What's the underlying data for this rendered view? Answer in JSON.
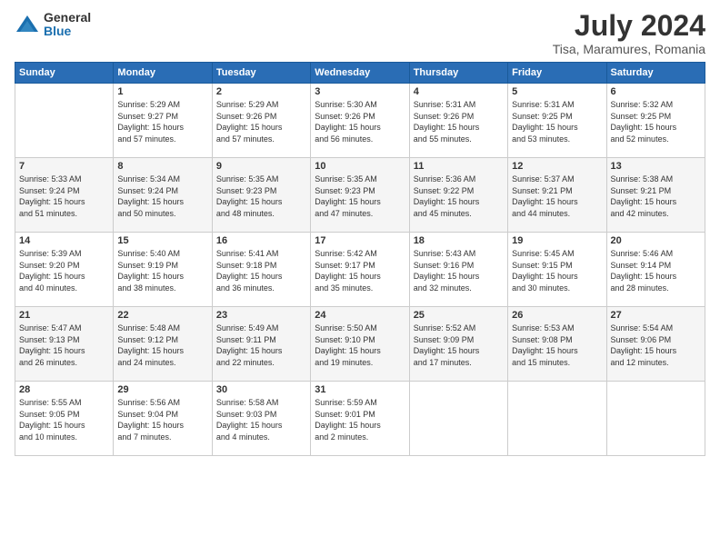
{
  "logo": {
    "general": "General",
    "blue": "Blue"
  },
  "title": "July 2024",
  "location": "Tisa, Maramures, Romania",
  "days_header": [
    "Sunday",
    "Monday",
    "Tuesday",
    "Wednesday",
    "Thursday",
    "Friday",
    "Saturday"
  ],
  "weeks": [
    [
      {
        "day": "",
        "content": ""
      },
      {
        "day": "1",
        "content": "Sunrise: 5:29 AM\nSunset: 9:27 PM\nDaylight: 15 hours\nand 57 minutes."
      },
      {
        "day": "2",
        "content": "Sunrise: 5:29 AM\nSunset: 9:26 PM\nDaylight: 15 hours\nand 57 minutes."
      },
      {
        "day": "3",
        "content": "Sunrise: 5:30 AM\nSunset: 9:26 PM\nDaylight: 15 hours\nand 56 minutes."
      },
      {
        "day": "4",
        "content": "Sunrise: 5:31 AM\nSunset: 9:26 PM\nDaylight: 15 hours\nand 55 minutes."
      },
      {
        "day": "5",
        "content": "Sunrise: 5:31 AM\nSunset: 9:25 PM\nDaylight: 15 hours\nand 53 minutes."
      },
      {
        "day": "6",
        "content": "Sunrise: 5:32 AM\nSunset: 9:25 PM\nDaylight: 15 hours\nand 52 minutes."
      }
    ],
    [
      {
        "day": "7",
        "content": "Sunrise: 5:33 AM\nSunset: 9:24 PM\nDaylight: 15 hours\nand 51 minutes."
      },
      {
        "day": "8",
        "content": "Sunrise: 5:34 AM\nSunset: 9:24 PM\nDaylight: 15 hours\nand 50 minutes."
      },
      {
        "day": "9",
        "content": "Sunrise: 5:35 AM\nSunset: 9:23 PM\nDaylight: 15 hours\nand 48 minutes."
      },
      {
        "day": "10",
        "content": "Sunrise: 5:35 AM\nSunset: 9:23 PM\nDaylight: 15 hours\nand 47 minutes."
      },
      {
        "day": "11",
        "content": "Sunrise: 5:36 AM\nSunset: 9:22 PM\nDaylight: 15 hours\nand 45 minutes."
      },
      {
        "day": "12",
        "content": "Sunrise: 5:37 AM\nSunset: 9:21 PM\nDaylight: 15 hours\nand 44 minutes."
      },
      {
        "day": "13",
        "content": "Sunrise: 5:38 AM\nSunset: 9:21 PM\nDaylight: 15 hours\nand 42 minutes."
      }
    ],
    [
      {
        "day": "14",
        "content": "Sunrise: 5:39 AM\nSunset: 9:20 PM\nDaylight: 15 hours\nand 40 minutes."
      },
      {
        "day": "15",
        "content": "Sunrise: 5:40 AM\nSunset: 9:19 PM\nDaylight: 15 hours\nand 38 minutes."
      },
      {
        "day": "16",
        "content": "Sunrise: 5:41 AM\nSunset: 9:18 PM\nDaylight: 15 hours\nand 36 minutes."
      },
      {
        "day": "17",
        "content": "Sunrise: 5:42 AM\nSunset: 9:17 PM\nDaylight: 15 hours\nand 35 minutes."
      },
      {
        "day": "18",
        "content": "Sunrise: 5:43 AM\nSunset: 9:16 PM\nDaylight: 15 hours\nand 32 minutes."
      },
      {
        "day": "19",
        "content": "Sunrise: 5:45 AM\nSunset: 9:15 PM\nDaylight: 15 hours\nand 30 minutes."
      },
      {
        "day": "20",
        "content": "Sunrise: 5:46 AM\nSunset: 9:14 PM\nDaylight: 15 hours\nand 28 minutes."
      }
    ],
    [
      {
        "day": "21",
        "content": "Sunrise: 5:47 AM\nSunset: 9:13 PM\nDaylight: 15 hours\nand 26 minutes."
      },
      {
        "day": "22",
        "content": "Sunrise: 5:48 AM\nSunset: 9:12 PM\nDaylight: 15 hours\nand 24 minutes."
      },
      {
        "day": "23",
        "content": "Sunrise: 5:49 AM\nSunset: 9:11 PM\nDaylight: 15 hours\nand 22 minutes."
      },
      {
        "day": "24",
        "content": "Sunrise: 5:50 AM\nSunset: 9:10 PM\nDaylight: 15 hours\nand 19 minutes."
      },
      {
        "day": "25",
        "content": "Sunrise: 5:52 AM\nSunset: 9:09 PM\nDaylight: 15 hours\nand 17 minutes."
      },
      {
        "day": "26",
        "content": "Sunrise: 5:53 AM\nSunset: 9:08 PM\nDaylight: 15 hours\nand 15 minutes."
      },
      {
        "day": "27",
        "content": "Sunrise: 5:54 AM\nSunset: 9:06 PM\nDaylight: 15 hours\nand 12 minutes."
      }
    ],
    [
      {
        "day": "28",
        "content": "Sunrise: 5:55 AM\nSunset: 9:05 PM\nDaylight: 15 hours\nand 10 minutes."
      },
      {
        "day": "29",
        "content": "Sunrise: 5:56 AM\nSunset: 9:04 PM\nDaylight: 15 hours\nand 7 minutes."
      },
      {
        "day": "30",
        "content": "Sunrise: 5:58 AM\nSunset: 9:03 PM\nDaylight: 15 hours\nand 4 minutes."
      },
      {
        "day": "31",
        "content": "Sunrise: 5:59 AM\nSunset: 9:01 PM\nDaylight: 15 hours\nand 2 minutes."
      },
      {
        "day": "",
        "content": ""
      },
      {
        "day": "",
        "content": ""
      },
      {
        "day": "",
        "content": ""
      }
    ]
  ]
}
